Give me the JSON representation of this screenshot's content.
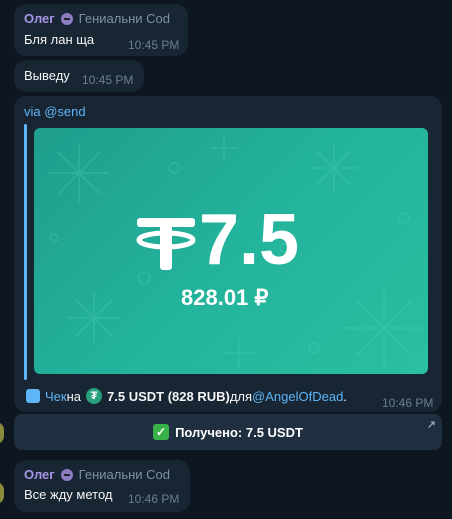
{
  "messages": [
    {
      "sender": "Олег",
      "signature": "Гениальни Cod",
      "text": "Бля лан ща",
      "time": "10:45 PM"
    },
    {
      "text": "Выведу",
      "time": "10:45 PM"
    }
  ],
  "send_message": {
    "via": "via ",
    "bot": "@send",
    "card": {
      "amount": "7.5",
      "rub": "828.01 ₽"
    },
    "check_word": "Чек",
    "on": " на ",
    "amount_text": "7.5 USDT (828 RUB)",
    "for": " для ",
    "recipient": "@AngelOfDead",
    "dot": ".",
    "time": "10:46 PM"
  },
  "inline_button": {
    "text": "Получено: 7.5 USDT"
  },
  "last_message": {
    "sender": "Олег",
    "signature": "Гениальни Cod",
    "text": "Все жду метод",
    "time": "10:46 PM"
  },
  "colors": {
    "accent": "#5eb5f7",
    "sender": "#a695e7",
    "card": "#23b39c",
    "bubble": "#182533",
    "background": "#0e1621"
  }
}
